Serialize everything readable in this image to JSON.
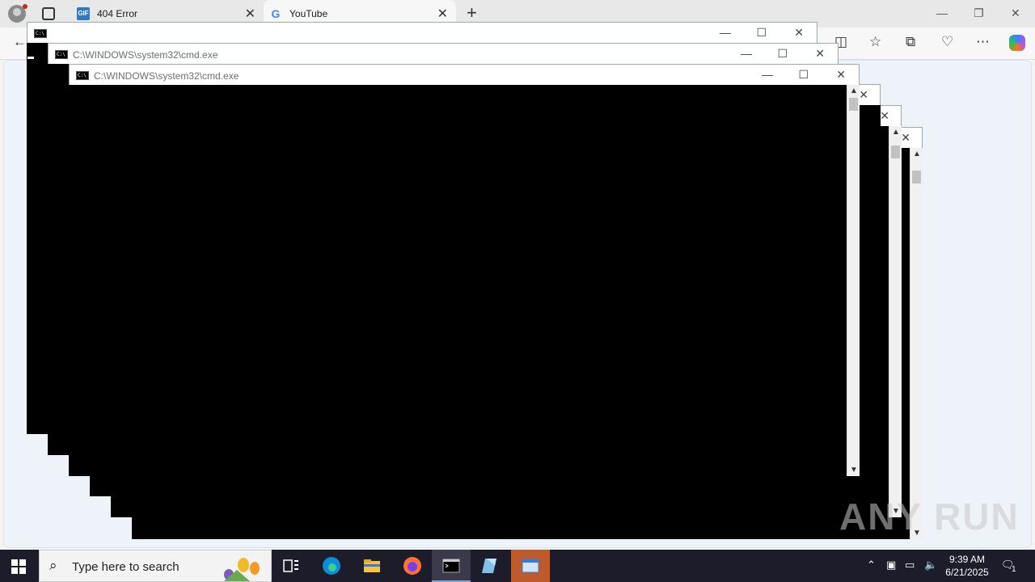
{
  "browser": {
    "tabs": [
      {
        "title": "404 Error",
        "favicon": "gif-icon"
      },
      {
        "title": "YouTube",
        "favicon": "google-icon"
      }
    ],
    "favicon_letter_gif": "GIF",
    "favicon_letter_google": "G"
  },
  "cmd_windows": [
    {
      "title": ""
    },
    {
      "title": "C:\\WINDOWS\\system32\\cmd.exe"
    },
    {
      "title": "C:\\WINDOWS\\system32\\cmd.exe"
    }
  ],
  "cmd_icon_text": "C:\\",
  "watermark": "ANY RUN",
  "taskbar": {
    "search_placeholder": "Type here to search",
    "time": "9:39 AM",
    "date": "6/21/2025",
    "notification_count": "1"
  },
  "colors": {
    "taskbar": "#1c1c2b",
    "console_bg": "#000000",
    "browser_accent": "#2f78c4"
  }
}
